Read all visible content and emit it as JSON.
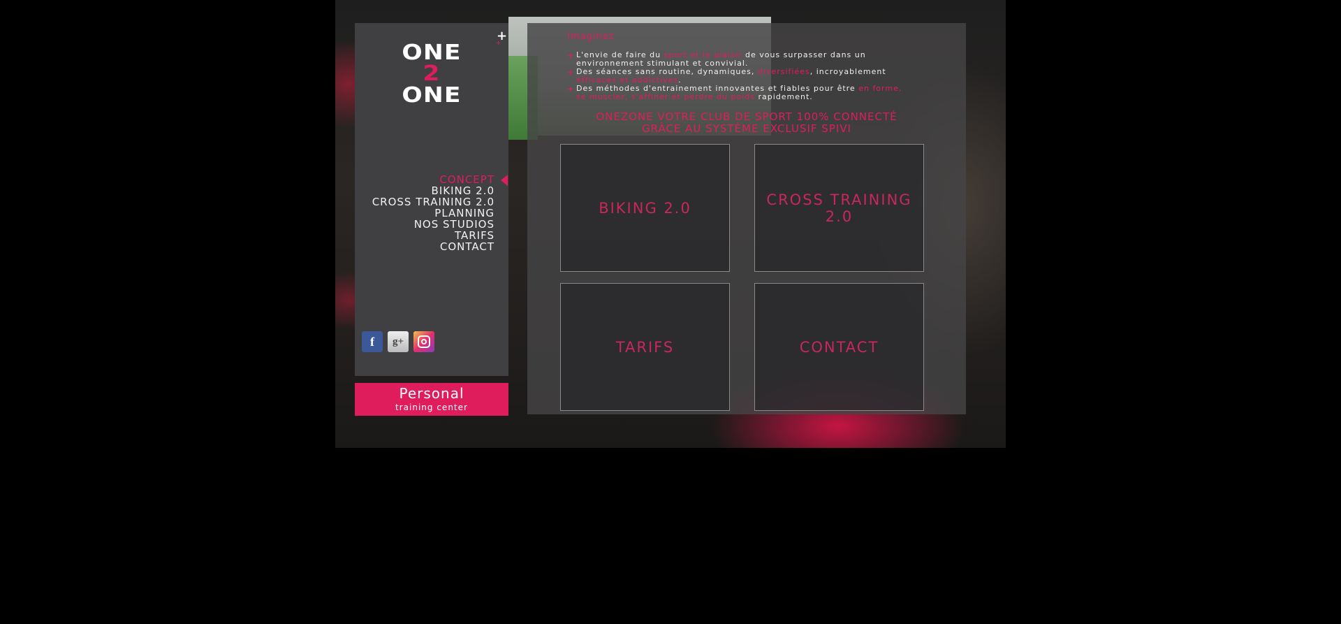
{
  "logo": {
    "line1": "ONE",
    "line2": "2",
    "line3": "ONE",
    "plus": "+"
  },
  "menu": {
    "items": [
      {
        "label": "CONCEPT",
        "active": true
      },
      {
        "label": "BIKING 2.0",
        "active": false
      },
      {
        "label": "CROSS TRAINING 2.0",
        "active": false
      },
      {
        "label": "PLANNING",
        "active": false
      },
      {
        "label": "NOS STUDIOS",
        "active": false
      },
      {
        "label": "TARIFS",
        "active": false
      },
      {
        "label": "CONTACT",
        "active": false
      }
    ]
  },
  "socials": {
    "facebook": "f",
    "googleplus": "g+",
    "instagram": "instagram-icon"
  },
  "badge": {
    "title": "Personal",
    "subtitle": "training center"
  },
  "main": {
    "headline": "Imaginez",
    "bullets": [
      {
        "parts": [
          "L'envie de faire du ",
          "sport et le plaisir",
          " de vous surpasser dans un environnement stimulant et convivial."
        ]
      },
      {
        "parts": [
          "Des séances sans routine, dynamiques, ",
          "diversifiées",
          ", incroyablement ",
          "efficaces et addictives",
          "."
        ]
      },
      {
        "parts": [
          "Des méthodes d'entrainement innovantes et fiables pour être ",
          "en forme, se muscler, s'affiner et perdre du poids",
          " rapidement."
        ]
      }
    ],
    "tagline_line1": "ONEZONE VOTRE CLUB DE SPORT 100% CONNECTÉ",
    "tagline_line2": "GRÂCE AU SYSTÈME EXCLUSIF SPIVI",
    "tiles": [
      "BIKING 2.0",
      "CROSS TRAINING 2.0",
      "TARIFS",
      "CONTACT"
    ]
  },
  "colors": {
    "accent": "#e01d5c",
    "sidebar": "#404042",
    "background": "#000000"
  }
}
